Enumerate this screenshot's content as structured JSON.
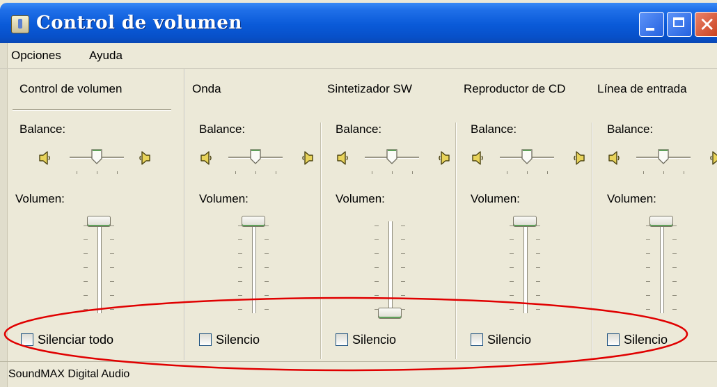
{
  "window": {
    "title": "Control de volumen",
    "controls": [
      "minimize",
      "maximize",
      "close"
    ],
    "close_glyph": "✕"
  },
  "menu": [
    "Opciones",
    "Ayuda"
  ],
  "labels": {
    "balance": "Balance:",
    "volume": "Volumen:"
  },
  "channels": [
    {
      "title": "Control de volumen",
      "mute_label": "Silenciar todo",
      "muted": false,
      "balance": 0.5,
      "volume": 1.0
    },
    {
      "title": "Onda",
      "mute_label": "Silencio",
      "muted": false,
      "balance": 0.5,
      "volume": 1.0
    },
    {
      "title": "Sintetizador SW",
      "mute_label": "Silencio",
      "muted": false,
      "balance": 0.5,
      "volume": 0.0
    },
    {
      "title": "Reproductor de CD",
      "mute_label": "Silencio",
      "muted": false,
      "balance": 0.5,
      "volume": 1.0
    },
    {
      "title": "Línea de entrada",
      "mute_label": "Silencio",
      "muted": false,
      "balance": 0.5,
      "volume": 1.0
    }
  ],
  "status": "SoundMAX Digital Audio",
  "icons": {
    "app": "volume-control-icon",
    "speaker_left": "speaker-left-icon",
    "speaker_right": "speaker-right-icon"
  },
  "colors": {
    "titlebar": "#0a5ad8",
    "annotation": "#e00000",
    "thumb_accent": "#5fa05a"
  }
}
